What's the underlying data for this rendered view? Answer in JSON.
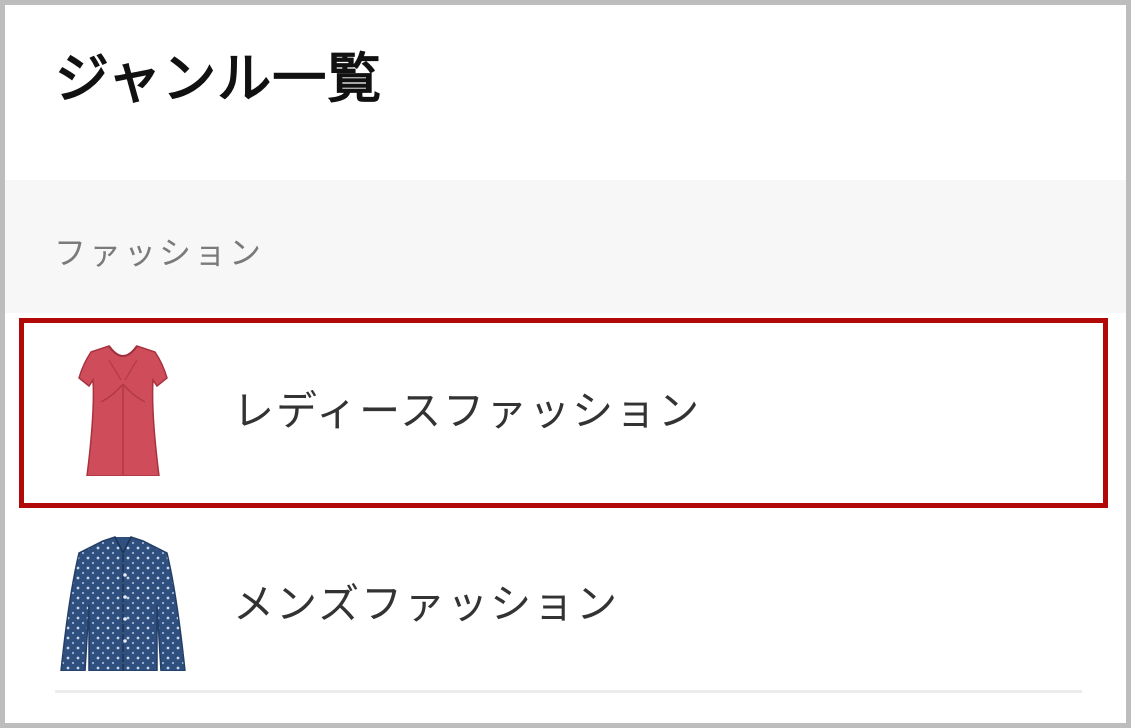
{
  "page": {
    "title": "ジャンル一覧"
  },
  "section": {
    "label": "ファッション"
  },
  "genres": [
    {
      "label": "レディースファッション",
      "thumbnail_icon": "red-blouse-icon",
      "highlighted": true
    },
    {
      "label": "メンズファッション",
      "thumbnail_icon": "blue-shirt-icon",
      "highlighted": false
    }
  ],
  "colors": {
    "highlight_border": "#b10808",
    "section_bg": "#f7f7f7",
    "section_label": "#7a7a7a",
    "item_text": "#333333",
    "blouse": "#cf4d5a",
    "shirt": "#2f4f7e"
  }
}
